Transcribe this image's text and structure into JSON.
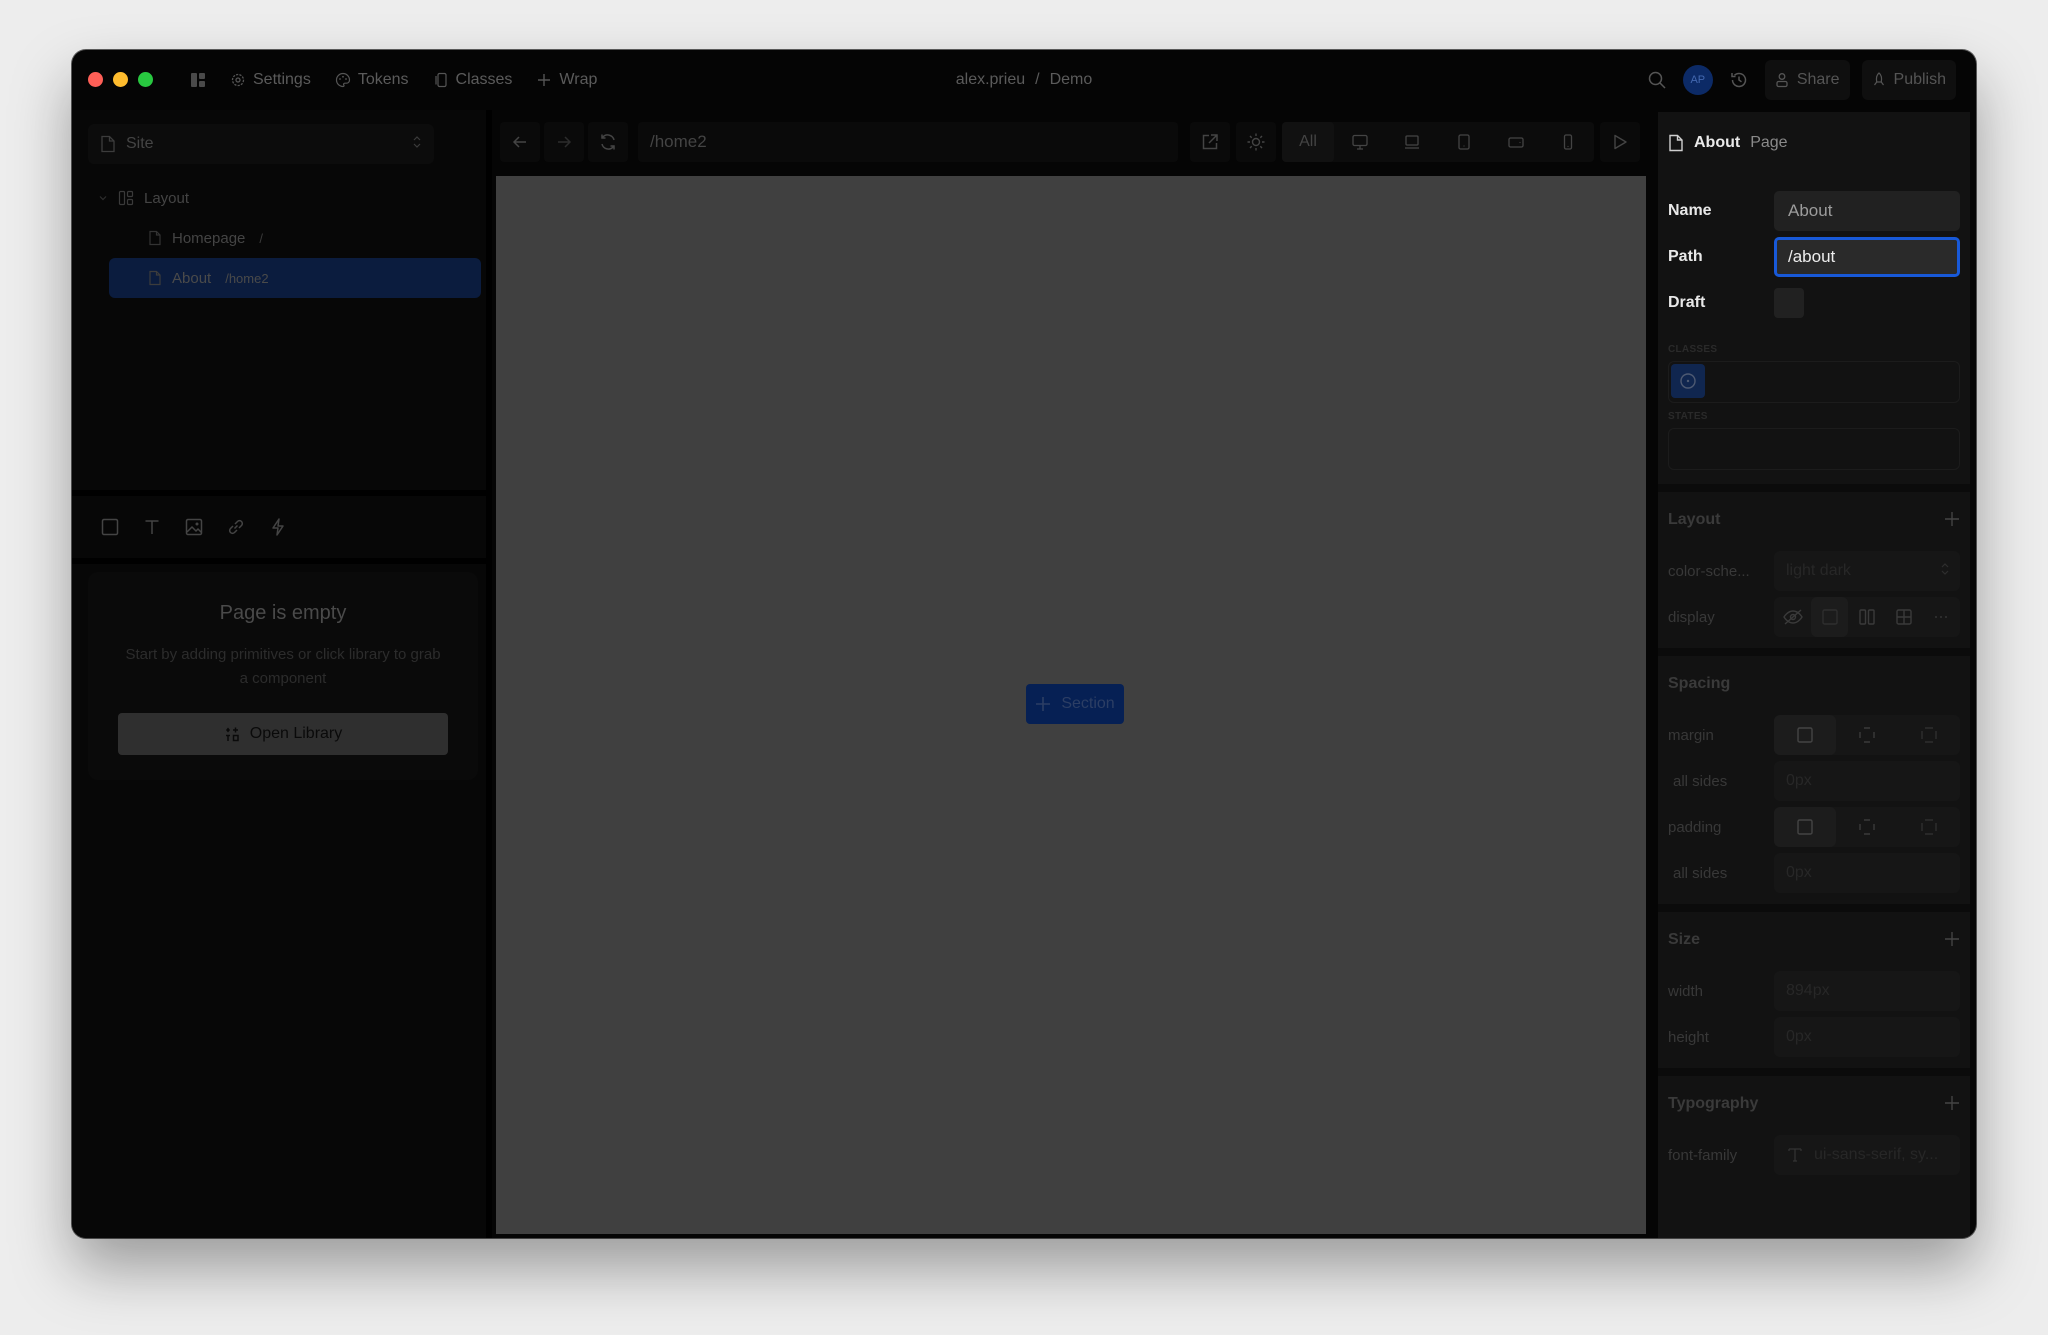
{
  "titlebar": {
    "menu": [
      {
        "label": "Settings",
        "icon": "gear-icon"
      },
      {
        "label": "Tokens",
        "icon": "palette-icon"
      },
      {
        "label": "Classes",
        "icon": "classes-icon"
      },
      {
        "label": "Wrap",
        "icon": "plus-icon"
      }
    ],
    "breadcrumb": {
      "user": "alex.prieu",
      "separator": "/",
      "project": "Demo"
    },
    "avatar_initials": "AP",
    "share_label": "Share",
    "publish_label": "Publish"
  },
  "left_panel": {
    "site_select": {
      "value": "Site"
    },
    "tree": {
      "layout_label": "Layout",
      "pages": [
        {
          "name": "Homepage",
          "path": "/",
          "selected": false
        },
        {
          "name": "About",
          "path": "/home2",
          "selected": true
        }
      ]
    },
    "primitives": [
      "box-icon",
      "text-icon",
      "image-icon",
      "link-icon",
      "lightning-icon"
    ],
    "empty_state": {
      "title": "Page is empty",
      "description": "Start by adding primitives or click library to grab a component",
      "button_label": "Open Library"
    }
  },
  "canvas": {
    "url": "/home2",
    "breakpoints": {
      "all_label": "All",
      "devices": [
        "desktop",
        "laptop",
        "tablet",
        "tablet-landscape",
        "mobile"
      ]
    },
    "section_button": "Section"
  },
  "right_panel": {
    "header": {
      "name": "About",
      "type": "Page"
    },
    "fields": {
      "name_label": "Name",
      "name_value": "About",
      "path_label": "Path",
      "path_value": "/about",
      "draft_label": "Draft"
    },
    "classes_label": "CLASSES",
    "states_label": "STATES",
    "layout": {
      "title": "Layout",
      "color_scheme_label": "color-sche...",
      "color_scheme_value": "light dark",
      "display_label": "display"
    },
    "spacing": {
      "title": "Spacing",
      "margin_label": "margin",
      "margin_sides_label": "all sides",
      "margin_value": "0px",
      "padding_label": "padding",
      "padding_sides_label": "all sides",
      "padding_value": "0px"
    },
    "size": {
      "title": "Size",
      "width_label": "width",
      "width_value": "894px",
      "height_label": "height",
      "height_value": "0px"
    },
    "typography": {
      "title": "Typography",
      "font_family_label": "font-family",
      "font_family_value": "ui-sans-serif, sy..."
    }
  }
}
